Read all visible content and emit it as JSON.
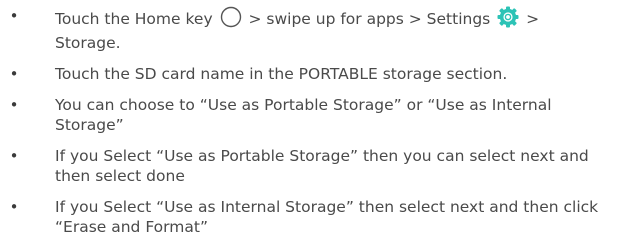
{
  "steps": [
    {
      "bullet": "•",
      "part1": "Touch the Home key ",
      "icon1": "home-circle-icon",
      "part2": " > swipe up for apps > Settings ",
      "icon2": "settings-gear-icon",
      "part3": " >",
      "part4": "Storage."
    },
    {
      "bullet": "•",
      "text": "Touch the SD card name in the PORTABLE storage section."
    },
    {
      "bullet": "•",
      "text": "You can choose to “Use as Portable Storage” or “Use as Internal Storage”"
    },
    {
      "bullet": "•",
      "text": "If you Select “Use as Portable Storage” then you can select next and then select done"
    },
    {
      "bullet": "•",
      "text": "If you Select “Use as Internal Storage” then select next and then click “Erase and Format”"
    }
  ],
  "colors": {
    "text": "#4a4a4a",
    "settings_icon": "#2cc3b6"
  }
}
